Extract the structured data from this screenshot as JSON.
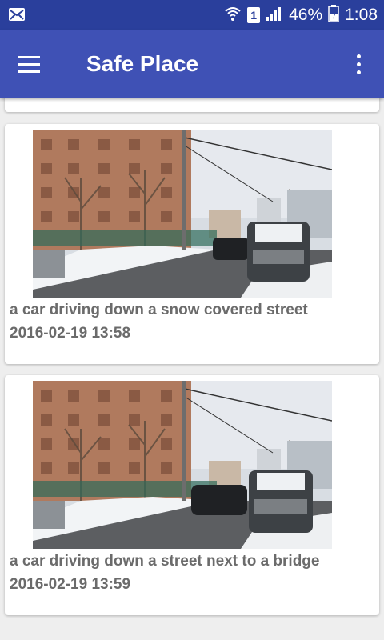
{
  "status_bar": {
    "battery_percent": "46%",
    "time": "1:08",
    "sim_slot": "1",
    "icons": [
      "mail-icon",
      "wifi-icon",
      "sim-icon",
      "signal-icon",
      "battery-icon"
    ]
  },
  "app_bar": {
    "title": "Safe Place",
    "menu_icon": "hamburger-menu-icon",
    "overflow_icon": "more-vert-icon",
    "color": "#3f51b5",
    "status_color": "#2a3f9c"
  },
  "feed": {
    "items": [
      {
        "caption": "a car driving down a snow covered street",
        "timestamp": "2016-02-19 13:58",
        "image": "dashcam-street-photo"
      },
      {
        "caption": "a car driving down a street next to a bridge",
        "timestamp": "2016-02-19 13:59",
        "image": "dashcam-street-photo"
      }
    ]
  }
}
